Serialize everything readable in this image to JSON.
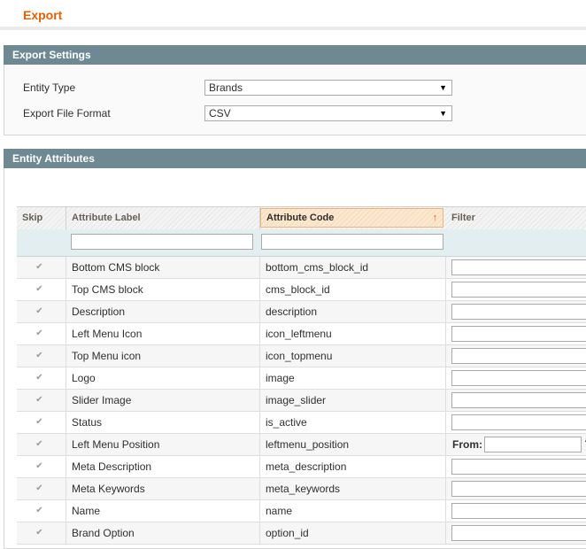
{
  "page": {
    "title": "Export"
  },
  "export_settings": {
    "header": "Export Settings",
    "entity_type": {
      "label": "Entity Type",
      "value": "Brands"
    },
    "file_format": {
      "label": "Export File Format",
      "value": "CSV"
    }
  },
  "entity_attributes": {
    "header": "Entity Attributes",
    "columns": {
      "skip": "Skip",
      "label": "Attribute Label",
      "code": "Attribute Code",
      "filter": "Filter"
    },
    "sort_indicator": "↑",
    "check_glyph": "✔",
    "rows": [
      {
        "label": "Bottom CMS block",
        "code": "bottom_cms_block_id",
        "filter": "text"
      },
      {
        "label": "Top CMS block",
        "code": "cms_block_id",
        "filter": "text"
      },
      {
        "label": "Description",
        "code": "description",
        "filter": "text"
      },
      {
        "label": "Left Menu Icon",
        "code": "icon_leftmenu",
        "filter": "text"
      },
      {
        "label": "Top Menu icon",
        "code": "icon_topmenu",
        "filter": "text"
      },
      {
        "label": "Logo",
        "code": "image",
        "filter": "text"
      },
      {
        "label": "Slider Image",
        "code": "image_slider",
        "filter": "text"
      },
      {
        "label": "Status",
        "code": "is_active",
        "filter": "text"
      },
      {
        "label": "Left Menu Position",
        "code": "leftmenu_position",
        "filter": "range",
        "from_label": "From:",
        "to_label": "T"
      },
      {
        "label": "Meta Description",
        "code": "meta_description",
        "filter": "text"
      },
      {
        "label": "Meta Keywords",
        "code": "meta_keywords",
        "filter": "text"
      },
      {
        "label": "Name",
        "code": "name",
        "filter": "text"
      },
      {
        "label": "Brand Option",
        "code": "option_id",
        "filter": "text"
      }
    ]
  }
}
